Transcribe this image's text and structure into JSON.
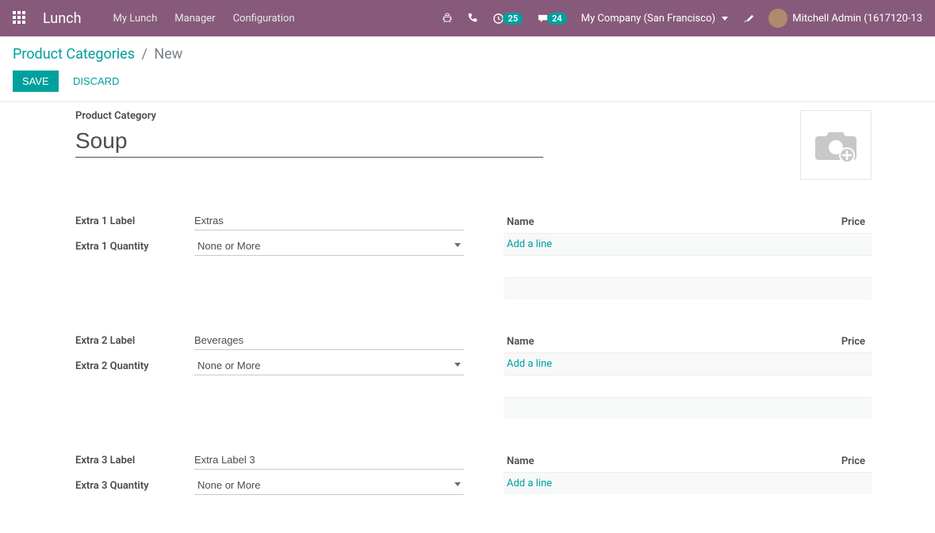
{
  "topnav": {
    "brand": "Lunch",
    "links": {
      "my_lunch": "My Lunch",
      "manager": "Manager",
      "configuration": "Configuration"
    },
    "badges": {
      "activities": "25",
      "messages": "24"
    },
    "company": "My Company (San Francisco)",
    "user": "Mitchell Admin (1617120-13"
  },
  "breadcrumb": {
    "parent": "Product Categories",
    "sep": "/",
    "current": "New"
  },
  "actions": {
    "save": "SAVE",
    "discard": "DISCARD"
  },
  "form": {
    "title_label": "Product Category",
    "title_value": "Soup",
    "extra1_label_label": "Extra 1 Label",
    "extra1_label_value": "Extras",
    "extra1_qty_label": "Extra 1 Quantity",
    "extra1_qty_value": "None or More",
    "extra2_label_label": "Extra 2 Label",
    "extra2_label_value": "Beverages",
    "extra2_qty_label": "Extra 2 Quantity",
    "extra2_qty_value": "None or More",
    "extra3_label_label": "Extra 3 Label",
    "extra3_label_value": "Extra Label 3",
    "extra3_qty_label": "Extra 3 Quantity",
    "extra3_qty_value": "None or More"
  },
  "grid": {
    "col_name": "Name",
    "col_price": "Price",
    "add_line": "Add a line"
  }
}
